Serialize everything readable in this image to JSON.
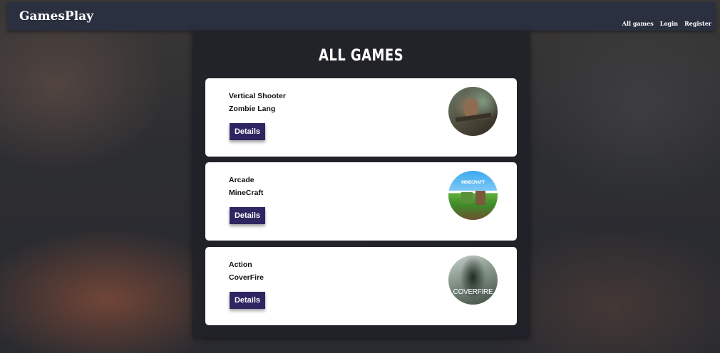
{
  "header": {
    "logo": "GamesPlay",
    "nav": [
      "All games",
      "Login",
      "Register"
    ]
  },
  "main": {
    "title": "ALL GAMES",
    "games": [
      {
        "genre": "Vertical Shooter",
        "title": "Zombie Lang",
        "button": "Details",
        "image_icon": "zombie-game-image"
      },
      {
        "genre": "Arcade",
        "title": "MineCraft",
        "button": "Details",
        "image_icon": "minecraft-game-image",
        "image_text": "MINECRAFT"
      },
      {
        "genre": "Action",
        "title": "CoverFire",
        "button": "Details",
        "image_icon": "coverfire-game-image",
        "image_text": "COVERFIRE"
      }
    ]
  },
  "colors": {
    "header_bg": "#2b3040",
    "panel_bg": "#212228",
    "button_bg": "#2d2660",
    "card_bg": "#ffffff"
  }
}
